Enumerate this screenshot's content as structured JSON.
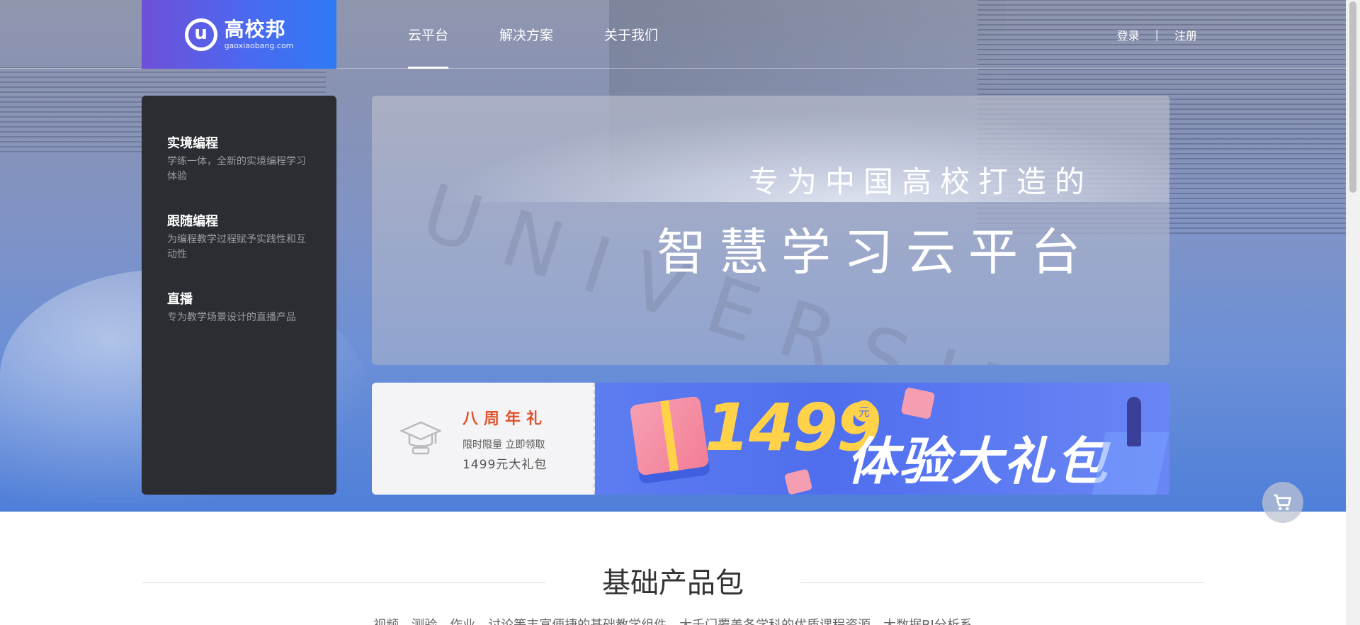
{
  "header": {
    "logo_cn": "高校邦",
    "logo_en": "gaoxiaobang.com",
    "nav": [
      {
        "label": "云平台",
        "active": true
      },
      {
        "label": "解决方案",
        "active": false
      },
      {
        "label": "关于我们",
        "active": false
      }
    ],
    "login": "登录",
    "separator": "|",
    "register": "注册"
  },
  "sidebar": {
    "items": [
      {
        "title": "实境编程",
        "desc": "学练一体，全新的实境编程学习体验"
      },
      {
        "title": "跟随编程",
        "desc": "为编程教学过程赋予实践性和互动性"
      },
      {
        "title": "直播",
        "desc": "专为教学场景设计的直播产品"
      }
    ]
  },
  "banner": {
    "watermark": "UNIVERSITY",
    "line1": "专为中国高校打造的",
    "line2": "智慧学习云平台"
  },
  "promo": {
    "title": "八周年礼",
    "sub1": "限时限量 立即领取",
    "sub2": "1499元大礼包",
    "price": "1499",
    "yuan": "元",
    "package": "体验大礼包"
  },
  "section": {
    "heading": "基础产品包",
    "subtitle": "视频、测验、作业、讨论等丰富便捷的基础教学组件，大千门覆盖各学科的优质课程资源，大数据BI分析系"
  },
  "colors": {
    "logo_gradient_start": "#6f4fd8",
    "logo_gradient_end": "#2f7af5",
    "sidebar_bg": "#2b2d33",
    "promo_title": "#e0532d",
    "promo_price": "#ffd24a"
  },
  "icons": {
    "cart": "shopping-cart-icon",
    "cap": "graduation-cap-icon"
  }
}
